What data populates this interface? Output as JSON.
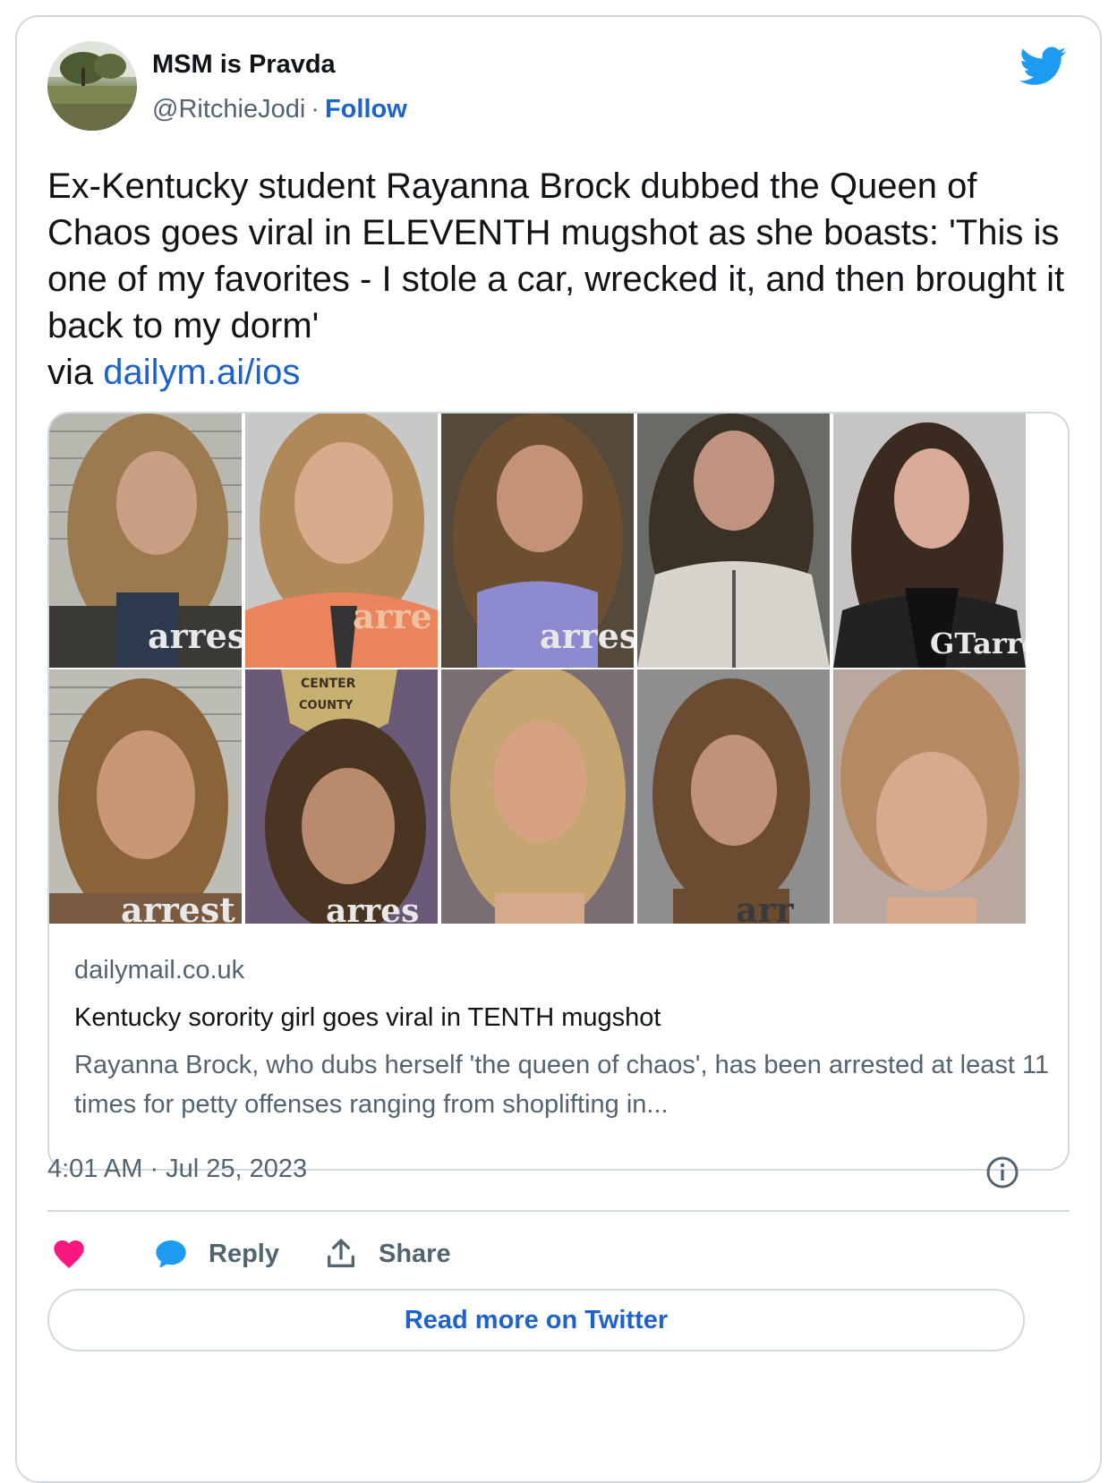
{
  "author": {
    "display_name": "MSM is Pravda",
    "handle": "@RitchieJodi",
    "separator": "·",
    "follow_label": "Follow"
  },
  "tweet": {
    "text": "Ex-Kentucky student Rayanna Brock dubbed the Queen of Chaos goes viral in ELEVENTH mugshot as she boasts: 'This is one of my favorites - I stole a car, wrecked it, and then brought it back to my dorm'",
    "via_label": "via",
    "link_text": "dailym.ai/ios"
  },
  "link_card": {
    "watermarks": [
      "arres",
      "arre",
      "arres",
      "",
      "GTarre",
      "arrest",
      "arres",
      "",
      "arr",
      ""
    ],
    "badge_lines": [
      "CENTER",
      "COUNTY"
    ],
    "domain": "dailymail.co.uk",
    "title": "Kentucky sorority girl goes viral in TENTH mugshot",
    "description": "Rayanna Brock, who dubs herself 'the queen of chaos', has been arrested at least 11 times for petty offenses ranging from shoplifting in..."
  },
  "timestamp": "4:01 AM · Jul 25, 2023",
  "actions": {
    "reply_label": "Reply",
    "share_label": "Share"
  },
  "read_more_label": "Read more on Twitter",
  "colors": {
    "link_blue": "#1d63c9",
    "twitter_blue": "#1d9bf0",
    "like_pink": "#f91880",
    "muted_gray": "#536471",
    "border": "#cfd9de"
  }
}
